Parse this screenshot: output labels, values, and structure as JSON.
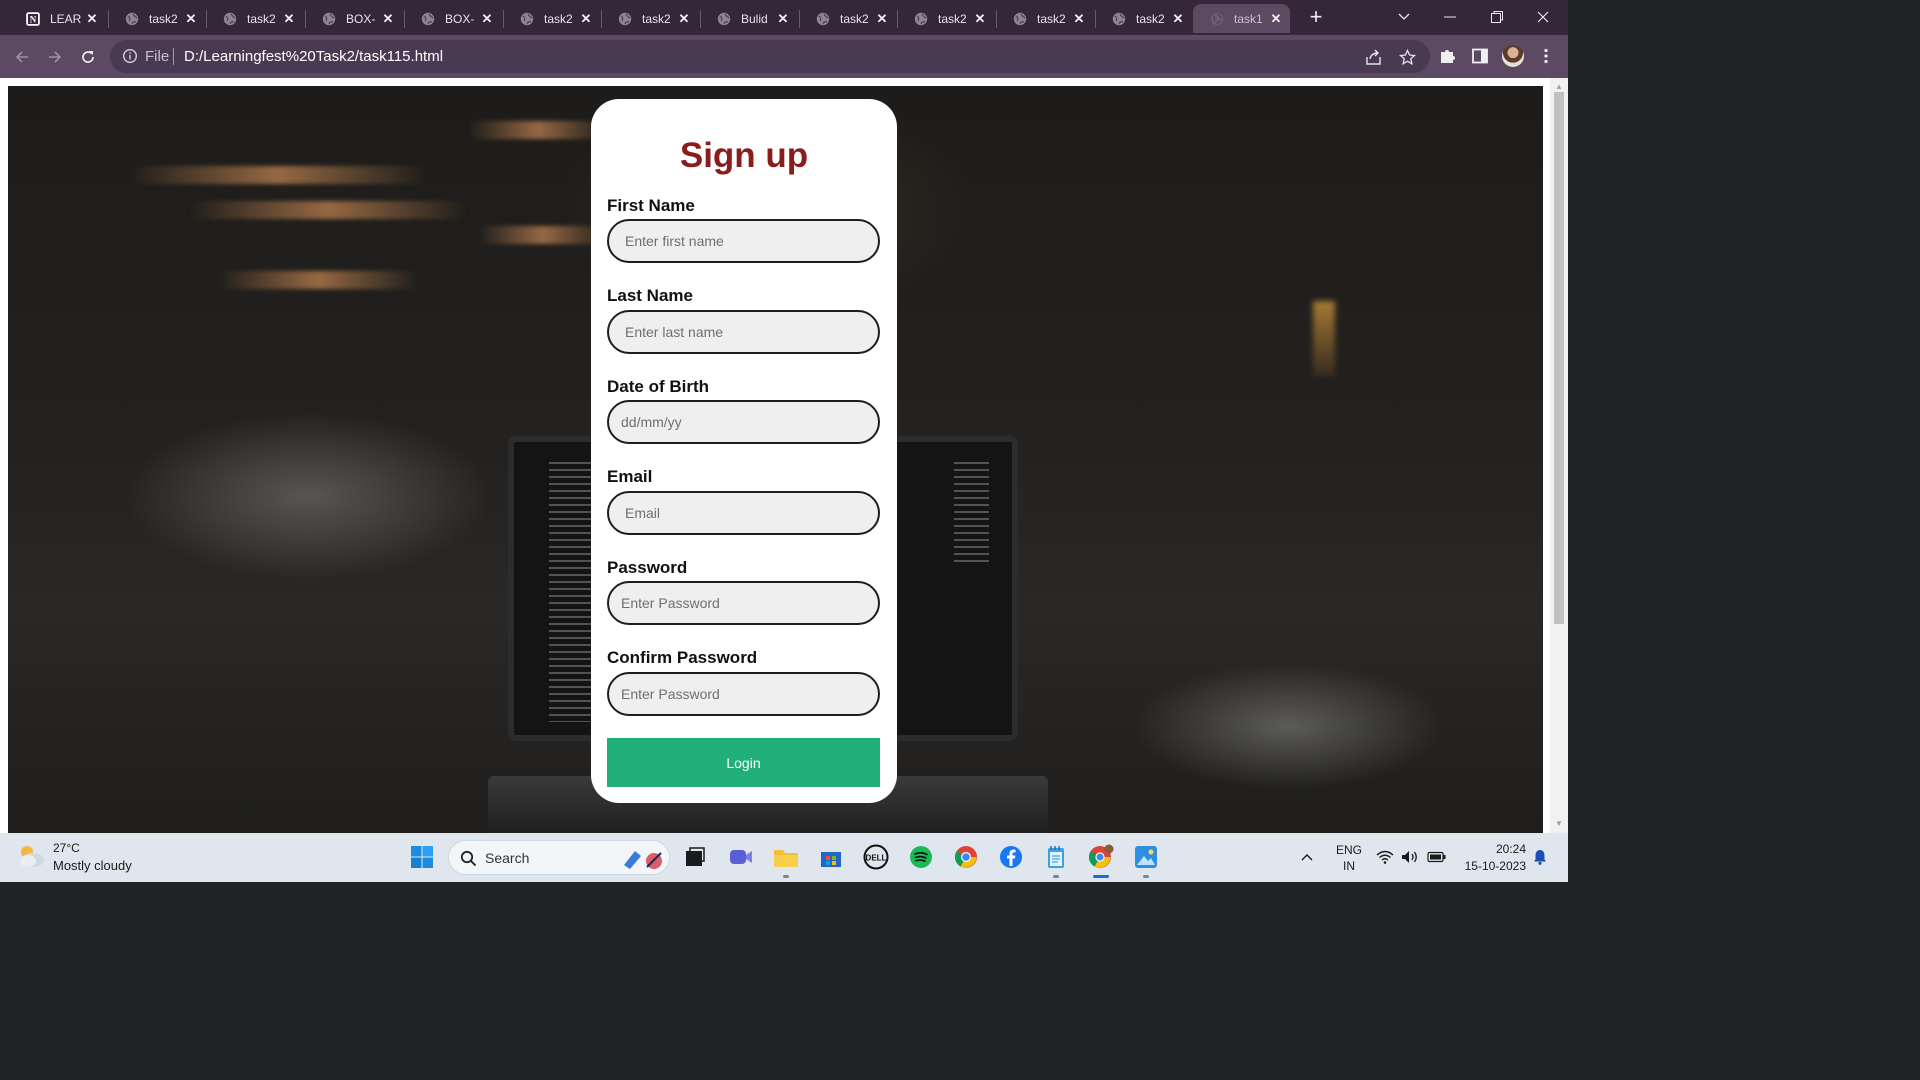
{
  "browser": {
    "tabs": [
      {
        "title": "LEAR",
        "favicon": "notion-icon",
        "active": false
      },
      {
        "title": "task2",
        "favicon": "globe-icon",
        "active": false
      },
      {
        "title": "task2",
        "favicon": "globe-icon",
        "active": false
      },
      {
        "title": "BOX-",
        "favicon": "globe-icon",
        "active": false
      },
      {
        "title": "BOX-",
        "favicon": "globe-icon",
        "active": false
      },
      {
        "title": "task2",
        "favicon": "globe-icon",
        "active": false
      },
      {
        "title": "task2",
        "favicon": "globe-icon",
        "active": false
      },
      {
        "title": "Bulid",
        "favicon": "globe-icon",
        "active": false
      },
      {
        "title": "task2",
        "favicon": "globe-icon",
        "active": false
      },
      {
        "title": "task2",
        "favicon": "globe-icon",
        "active": false
      },
      {
        "title": "task2",
        "favicon": "globe-icon",
        "active": false
      },
      {
        "title": "task2",
        "favicon": "globe-icon",
        "active": false
      },
      {
        "title": "task1",
        "favicon": "globe-icon",
        "active": true
      }
    ],
    "address": {
      "scheme_label": "File",
      "url": "D:/Learningfest%20Task2/task115.html"
    },
    "colors": {
      "frame": "#35263a",
      "toolbar": "#5c4a63",
      "omnibox": "#4a3a51"
    }
  },
  "form": {
    "title": "Sign up",
    "fields": [
      {
        "label": "First Name",
        "placeholder": "Enter first name",
        "value": ""
      },
      {
        "label": "Last Name",
        "placeholder": "Enter last name",
        "value": ""
      },
      {
        "label": "Date of Birth",
        "placeholder": "dd/mm/yy",
        "value": ""
      },
      {
        "label": "Email",
        "placeholder": "Email",
        "value": ""
      },
      {
        "label": "Password",
        "placeholder": "Enter Password",
        "value": ""
      },
      {
        "label": "Confirm Password",
        "placeholder": "Enter Password",
        "value": ""
      }
    ],
    "submit_label": "Login",
    "colors": {
      "title": "#8b1c1c",
      "button": "#21b07a",
      "input_bg": "#efefef"
    }
  },
  "taskbar": {
    "weather": {
      "temp": "27°C",
      "desc": "Mostly cloudy"
    },
    "search_label": "Search",
    "pinned": [
      "windows-start-icon",
      "search-icon",
      "task-view-icon",
      "meet-icon",
      "file-explorer-icon",
      "store-icon",
      "dell-icon",
      "spotify-icon",
      "chrome-icon",
      "facebook-icon",
      "notepad-icon",
      "chrome-profile-icon",
      "photos-icon"
    ],
    "tray": {
      "lang_top": "ENG",
      "lang_bottom": "IN",
      "time": "20:24",
      "date": "15-10-2023"
    }
  }
}
